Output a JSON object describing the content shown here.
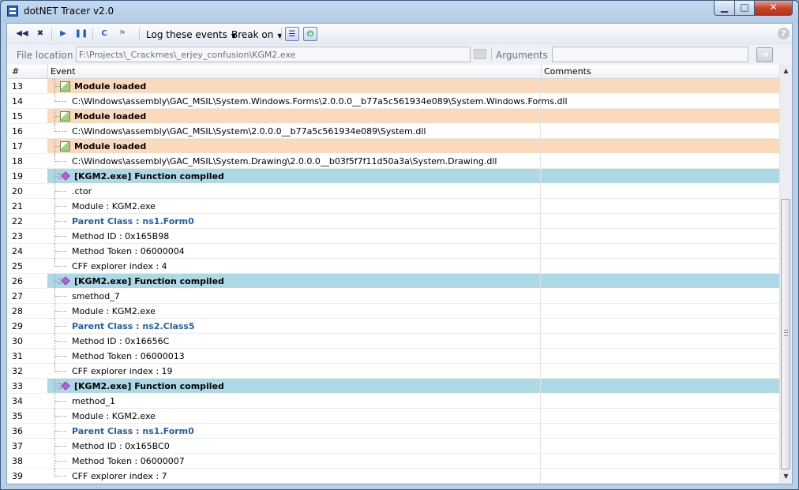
{
  "window": {
    "title": "dotNET Tracer v2.0",
    "controls": {
      "minimize": "▁",
      "maximize": "□",
      "close": "✕"
    }
  },
  "toolbar": {
    "buttons": [
      {
        "name": "rewind-icon",
        "glyph": "◀◀"
      },
      {
        "name": "stop-icon",
        "glyph": "✖"
      },
      {
        "name": "play-icon",
        "glyph": "▶"
      },
      {
        "name": "pause-icon",
        "glyph": "❚❚"
      },
      {
        "name": "clear-icon",
        "glyph": "C"
      },
      {
        "name": "filter-icon",
        "glyph": "⚑"
      }
    ],
    "log_events_label": "Log these events",
    "break_on_label": "Break on",
    "help": "?"
  },
  "address": {
    "file_location_label": "File location :",
    "file_location_value": "F:\\Projects\\_Crackmes\\_erjey_confusion\\KGM2.exe",
    "arguments_label": "Arguments :",
    "arguments_value": "",
    "go_glyph": "➔"
  },
  "grid": {
    "columns": {
      "num": "#",
      "event": "Event",
      "comments": "Comments"
    },
    "rows": [
      {
        "n": "13",
        "text": "Module loaded",
        "kind": "module"
      },
      {
        "n": "14",
        "text": "C:\\Windows\\assembly\\GAC_MSIL\\System.Windows.Forms\\2.0.0.0__b77a5c561934e089\\System.Windows.Forms.dll",
        "kind": "child",
        "last": true
      },
      {
        "n": "15",
        "text": "Module loaded",
        "kind": "module"
      },
      {
        "n": "16",
        "text": "C:\\Windows\\assembly\\GAC_MSIL\\System\\2.0.0.0__b77a5c561934e089\\System.dll",
        "kind": "child",
        "last": true
      },
      {
        "n": "17",
        "text": "Module loaded",
        "kind": "module"
      },
      {
        "n": "18",
        "text": "C:\\Windows\\assembly\\GAC_MSIL\\System.Drawing\\2.0.0.0__b03f5f7f11d50a3a\\System.Drawing.dll",
        "kind": "child",
        "last": true
      },
      {
        "n": "19",
        "text": "[KGM2.exe] Function compiled",
        "kind": "func"
      },
      {
        "n": "20",
        "text": ".ctor",
        "kind": "child"
      },
      {
        "n": "21",
        "text": "Module : KGM2.exe",
        "kind": "child"
      },
      {
        "n": "22",
        "text": "Parent Class : ns1.Form0",
        "kind": "parent"
      },
      {
        "n": "23",
        "text": "Method ID : 0x165B98",
        "kind": "child"
      },
      {
        "n": "24",
        "text": "Method Token : 06000004",
        "kind": "child"
      },
      {
        "n": "25",
        "text": "CFF explorer index : 4",
        "kind": "child",
        "last": true
      },
      {
        "n": "26",
        "text": "[KGM2.exe] Function compiled",
        "kind": "func"
      },
      {
        "n": "27",
        "text": "smethod_7",
        "kind": "child"
      },
      {
        "n": "28",
        "text": "Module : KGM2.exe",
        "kind": "child"
      },
      {
        "n": "29",
        "text": "Parent Class : ns2.Class5",
        "kind": "parent"
      },
      {
        "n": "30",
        "text": "Method ID : 0x16656C",
        "kind": "child"
      },
      {
        "n": "31",
        "text": "Method Token : 06000013",
        "kind": "child"
      },
      {
        "n": "32",
        "text": "CFF explorer index : 19",
        "kind": "child",
        "last": true
      },
      {
        "n": "33",
        "text": "[KGM2.exe] Function compiled",
        "kind": "func"
      },
      {
        "n": "34",
        "text": "method_1",
        "kind": "child"
      },
      {
        "n": "35",
        "text": "Module : KGM2.exe",
        "kind": "child"
      },
      {
        "n": "36",
        "text": "Parent Class : ns1.Form0",
        "kind": "parent"
      },
      {
        "n": "37",
        "text": "Method ID : 0x165BC0",
        "kind": "child"
      },
      {
        "n": "38",
        "text": "Method Token : 06000007",
        "kind": "child"
      },
      {
        "n": "39",
        "text": "CFF explorer index : 7",
        "kind": "child",
        "last": true
      }
    ]
  },
  "scrollbar": {
    "up": "▲",
    "down": "▼"
  }
}
